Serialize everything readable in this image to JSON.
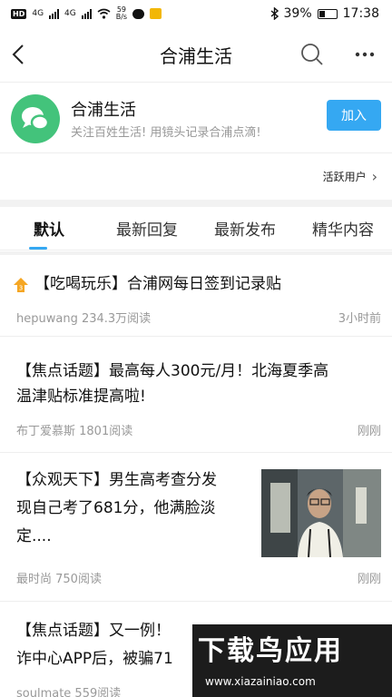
{
  "status_bar": {
    "hd": "HD",
    "net1": "4G",
    "net2": "4G",
    "speed_value": "59",
    "speed_unit": "B/s",
    "battery": "39%",
    "time": "17:38"
  },
  "nav": {
    "title": "合浦生活",
    "icons": [
      "back-arrow-icon",
      "search-icon",
      "more-icon"
    ]
  },
  "group": {
    "name": "合浦生活",
    "description": "关注百姓生活! 用镜头记录合浦点滴!",
    "join_label": "加入",
    "logo_color": "#43c37b",
    "accent": "#35a8f2"
  },
  "active_users": {
    "label": "活跃用户",
    "chevron": "›"
  },
  "tabs": [
    {
      "label": "默认",
      "active": true
    },
    {
      "label": "最新回复",
      "active": false
    },
    {
      "label": "最新发布",
      "active": false
    },
    {
      "label": "精华内容",
      "active": false
    }
  ],
  "posts": [
    {
      "title": "【吃喝玩乐】合浦网每日签到记录贴",
      "author_views": "hepuwang 234.3万阅读",
      "time": "3小时前",
      "pinned": true
    },
    {
      "title_line1": "【焦点话题】最高每人300元/月！北海夏季高",
      "title_line2": "温津贴标准提高啦!",
      "author_views": "布丁爱慕斯 1801阅读",
      "time": "刚刚"
    },
    {
      "title_line1": "【众观天下】男生高考查分发",
      "title_line2": "现自己考了681分，他满脸淡",
      "title_line3": "定....",
      "author_views": "最时尚 750阅读",
      "time": "刚刚"
    },
    {
      "title_line1": "【焦点话题】又一例！",
      "title_line2": "诈中心APP后，被骗71",
      "author_views": "soulmate 559阅读"
    }
  ],
  "watermark": {
    "main": "下载鸟应用",
    "url": "www.xiazainiao.com"
  }
}
